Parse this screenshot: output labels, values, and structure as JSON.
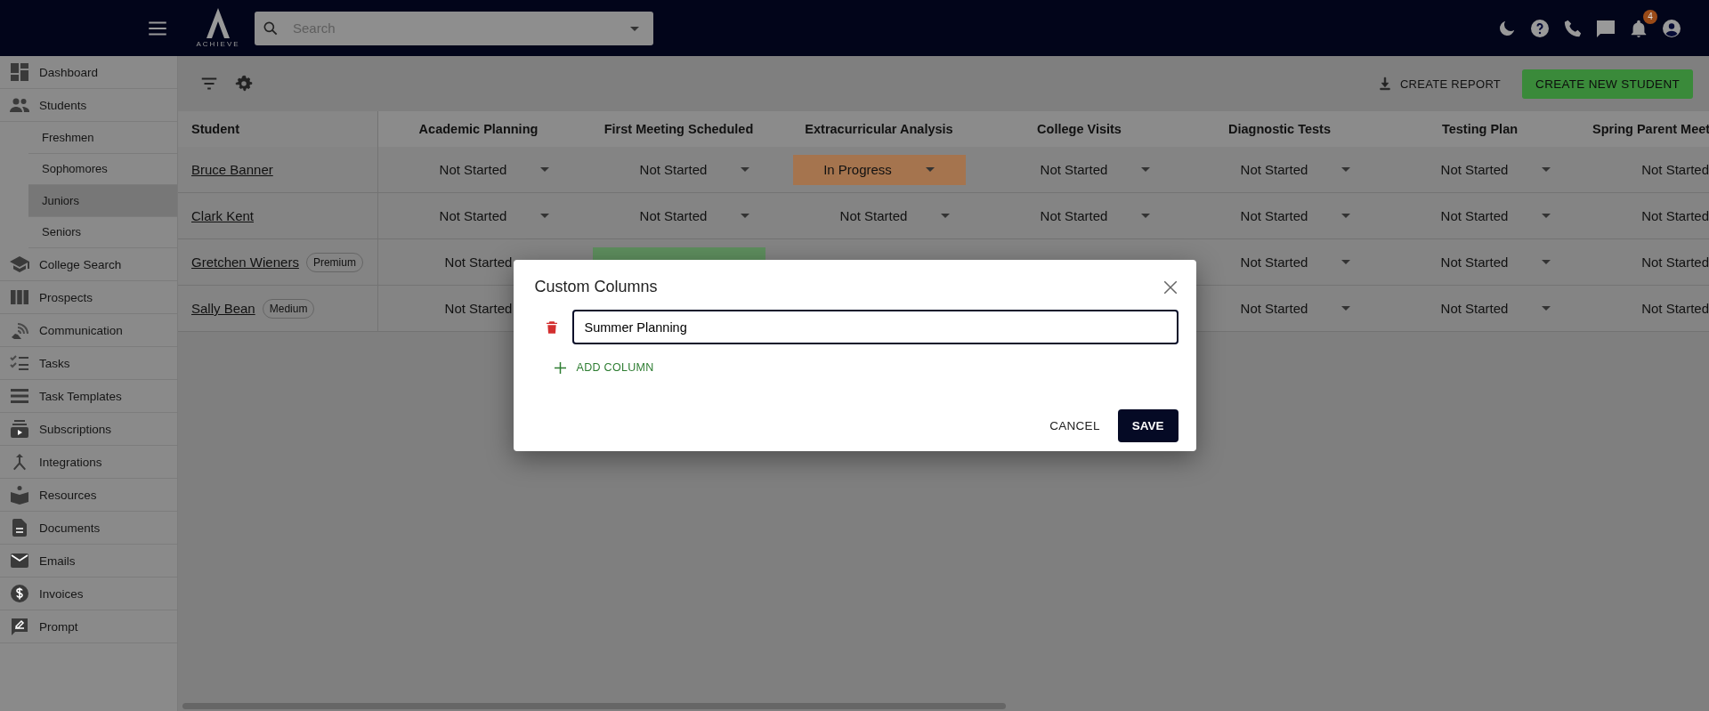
{
  "topbar": {
    "logo_text": "ACHIEVE",
    "search": {
      "placeholder": "Search"
    },
    "notifications": {
      "count": "4"
    }
  },
  "sidebar": {
    "items": [
      {
        "label": "Dashboard",
        "selected": false
      },
      {
        "label": "Students",
        "selected": false,
        "children": [
          {
            "label": "Freshmen",
            "selected": false
          },
          {
            "label": "Sophomores",
            "selected": false
          },
          {
            "label": "Juniors",
            "selected": true
          },
          {
            "label": "Seniors",
            "selected": false
          }
        ]
      },
      {
        "label": "College Search",
        "selected": false
      },
      {
        "label": "Prospects",
        "selected": false
      },
      {
        "label": "Communication",
        "selected": false
      },
      {
        "label": "Tasks",
        "selected": false
      },
      {
        "label": "Task Templates",
        "selected": false
      },
      {
        "label": "Subscriptions",
        "selected": false
      },
      {
        "label": "Integrations",
        "selected": false
      },
      {
        "label": "Resources",
        "selected": false
      },
      {
        "label": "Documents",
        "selected": false
      },
      {
        "label": "Emails",
        "selected": false
      },
      {
        "label": "Invoices",
        "selected": false
      },
      {
        "label": "Prompt",
        "selected": false
      }
    ]
  },
  "toolbar": {
    "report_button": "CREATE REPORT",
    "create_button": "CREATE NEW STUDENT"
  },
  "table": {
    "columns": [
      "Student",
      "Academic Planning",
      "First Meeting Scheduled",
      "Extracurricular Analysis",
      "College Visits",
      "Diagnostic Tests",
      "Testing Plan",
      "Spring Parent Meet"
    ],
    "rows": [
      {
        "cells": [
          {
            "value": "Bruce Banner"
          },
          {
            "value": "Not Started",
            "dropdown": true
          },
          {
            "value": "Not Started",
            "dropdown": true
          },
          {
            "value": "In Progress",
            "dropdown": true,
            "color": "#a5744e"
          },
          {
            "value": "Not Started",
            "dropdown": true
          },
          {
            "value": "Not Started",
            "dropdown": true
          },
          {
            "value": "Not Started",
            "dropdown": true
          },
          {
            "value": "Not Started",
            "dropdown": false
          }
        ]
      },
      {
        "cells": [
          {
            "value": "Clark Kent"
          },
          {
            "value": "Not Started",
            "dropdown": true
          },
          {
            "value": "Not Started",
            "dropdown": true
          },
          {
            "value": "Not Started",
            "dropdown": true
          },
          {
            "value": "Not Started",
            "dropdown": true
          },
          {
            "value": "Not Started",
            "dropdown": true
          },
          {
            "value": "Not Started",
            "dropdown": true
          },
          {
            "value": "Not Started",
            "dropdown": false
          }
        ]
      },
      {
        "cells": [
          {
            "value": "Gretchen Wieners",
            "badge": "Premium"
          },
          {
            "value": "Not Started",
            "dropdown": false
          },
          {
            "color": "#5e8e5e"
          },
          null,
          null,
          {
            "value": "Not Started",
            "dropdown": true
          },
          {
            "value": "Not Started",
            "dropdown": true
          },
          {
            "value": "Not Started",
            "dropdown": false
          }
        ]
      },
      {
        "cells": [
          {
            "value": "Sally Bean",
            "badge": "Medium"
          },
          {
            "value": "Not Started",
            "dropdown": false
          },
          null,
          null,
          null,
          {
            "value": "Not Started",
            "dropdown": true
          },
          {
            "value": "Not Started",
            "dropdown": true
          },
          {
            "value": "Not Started",
            "dropdown": false
          }
        ]
      }
    ]
  },
  "modal": {
    "title": "Custom Columns",
    "columns": [
      {
        "value": "Summer Planning"
      }
    ],
    "add_button": "ADD COLUMN",
    "cancel_button": "CANCEL",
    "save_button": "SAVE"
  }
}
